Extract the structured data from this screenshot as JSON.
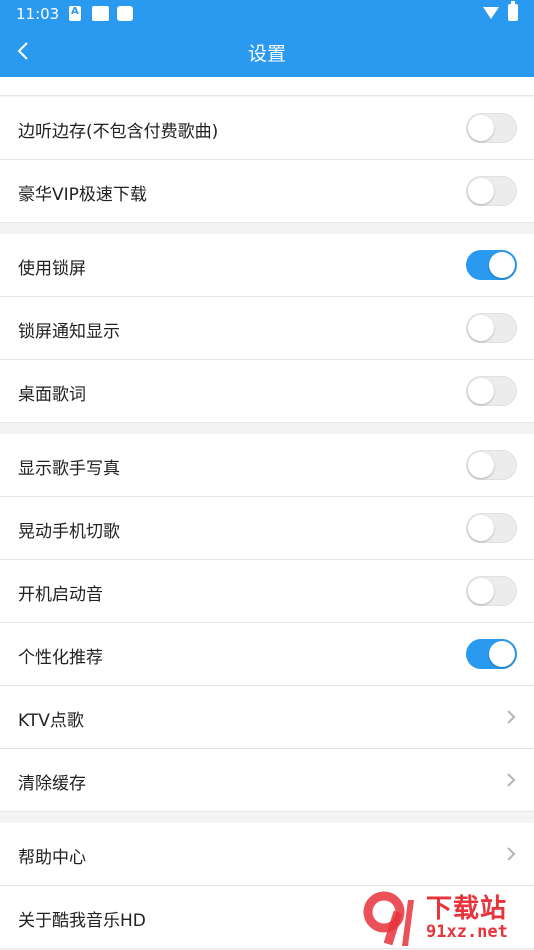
{
  "status_bar": {
    "time": "11:03"
  },
  "app_bar": {
    "title": "设置"
  },
  "settings": [
    {
      "label": "边听边存(不包含付费歌曲)",
      "control": "toggle",
      "on": false
    },
    {
      "label": "豪华VIP极速下载",
      "control": "toggle",
      "on": false
    },
    {
      "label": "使用锁屏",
      "control": "toggle",
      "on": true
    },
    {
      "label": "锁屏通知显示",
      "control": "toggle",
      "on": false
    },
    {
      "label": "桌面歌词",
      "control": "toggle",
      "on": false
    },
    {
      "label": "显示歌手写真",
      "control": "toggle",
      "on": false
    },
    {
      "label": "晃动手机切歌",
      "control": "toggle",
      "on": false
    },
    {
      "label": "开机启动音",
      "control": "toggle",
      "on": false
    },
    {
      "label": "个性化推荐",
      "control": "toggle",
      "on": true
    },
    {
      "label": "KTV点歌",
      "control": "chevron"
    },
    {
      "label": "清除缓存",
      "control": "chevron"
    },
    {
      "label": "帮助中心",
      "control": "chevron"
    },
    {
      "label": "关于酷我音乐HD",
      "control": "none"
    }
  ],
  "watermark": {
    "text": "下载站",
    "url": "91xz.net"
  },
  "colors": {
    "accent": "#2a9af0",
    "toggle_off": "#ececec",
    "watermark": "#e8333b"
  }
}
